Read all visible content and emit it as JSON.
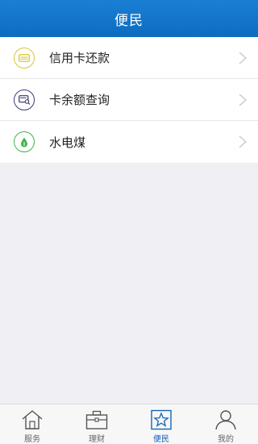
{
  "header": {
    "title": "便民"
  },
  "items": [
    {
      "label": "信用卡还款",
      "icon": "credit-card-icon",
      "color": "#d8c63a"
    },
    {
      "label": "卡余额查询",
      "icon": "card-search-icon",
      "color": "#3b3f7a"
    },
    {
      "label": "水电煤",
      "icon": "water-drop-icon",
      "color": "#3cb54a"
    }
  ],
  "tabbar": {
    "tabs": [
      {
        "label": "服务",
        "icon": "home-icon",
        "active": false
      },
      {
        "label": "理财",
        "icon": "briefcase-icon",
        "active": false
      },
      {
        "label": "便民",
        "icon": "star-icon",
        "active": true
      },
      {
        "label": "我的",
        "icon": "person-icon",
        "active": false
      }
    ]
  },
  "colors": {
    "header_bg": "#0d6cc0",
    "active_tab": "#1565b6",
    "content_bg": "#efeff4"
  }
}
